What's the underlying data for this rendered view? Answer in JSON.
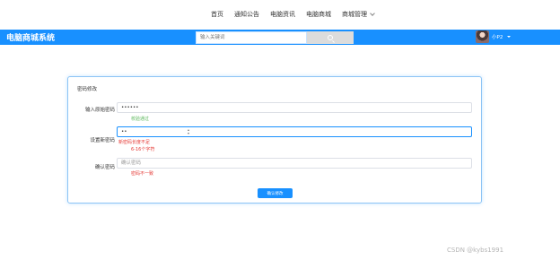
{
  "nav": {
    "links": [
      "首页",
      "通知公告",
      "电脑资讯",
      "电脑商城"
    ],
    "dropdown_label": "商城管理"
  },
  "header": {
    "brand": "电脑商城系统",
    "search_placeholder": "输入关键词",
    "username": "小P2",
    "bg_color": "#1890ff"
  },
  "form": {
    "title": "密码修改",
    "old_password": {
      "label": "输入原始密码",
      "value": "••••••",
      "hint": "校验通过"
    },
    "new_password": {
      "label": "设置新密码",
      "value": "••",
      "error1": "新密码长度不足",
      "error2": "6-16个字符"
    },
    "confirm_password": {
      "label": "确认密码",
      "placeholder": "确认密码",
      "error": "密码不一致"
    },
    "submit_label": "确认修改"
  },
  "watermark": "CSDN @kybs1991"
}
